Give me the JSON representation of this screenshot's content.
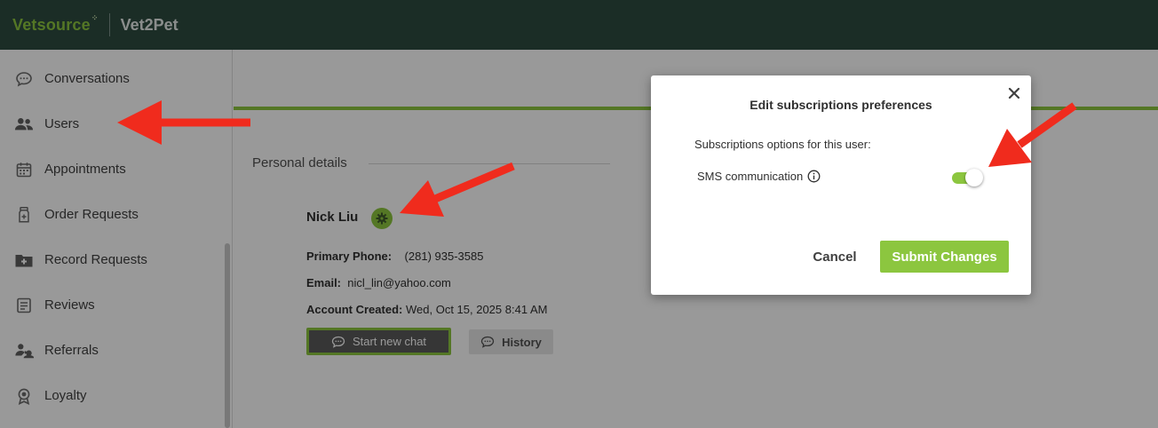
{
  "header": {
    "brand": "Vetsource",
    "product": "Vet2Pet"
  },
  "sidebar": {
    "items": [
      {
        "label": "Conversations",
        "icon": "chat-bubble-icon"
      },
      {
        "label": "Users",
        "icon": "users-icon"
      },
      {
        "label": "Appointments",
        "icon": "calendar-icon"
      },
      {
        "label": "Order Requests",
        "icon": "bottle-icon"
      },
      {
        "label": "Record Requests",
        "icon": "medical-record-icon"
      },
      {
        "label": "Reviews",
        "icon": "clipboard-icon"
      },
      {
        "label": "Referrals",
        "icon": "referrals-icon"
      },
      {
        "label": "Loyalty",
        "icon": "badge-icon"
      }
    ]
  },
  "profile": {
    "section_title": "Personal details",
    "name": "Nick Liu",
    "phone_label": "Primary Phone:",
    "phone": "(281) 935-3585",
    "email_label": "Email:",
    "email": "nicl_lin@yahoo.com",
    "created_label": "Account Created:",
    "created": "Wed, Oct 15, 2025 8:41 AM",
    "start_chat_label": "Start new chat",
    "history_label": "History"
  },
  "modal": {
    "title": "Edit subscriptions preferences",
    "subtitle": "Subscriptions options for this user:",
    "sms_label": "SMS communication",
    "sms_enabled": true,
    "cancel_label": "Cancel",
    "submit_label": "Submit Changes"
  },
  "colors": {
    "header_bg": "#2e4b40",
    "accent_green": "#8cc63f",
    "annotation_red": "#f02b1d"
  }
}
